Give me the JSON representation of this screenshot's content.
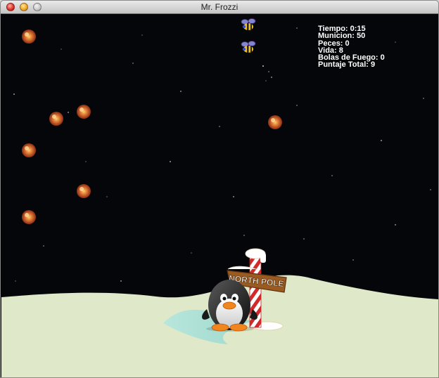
{
  "window": {
    "title": "Mr. Frozzi"
  },
  "hud": {
    "time": {
      "label": "Tiempo:",
      "value": "0:15"
    },
    "ammo": {
      "label": "Municion:",
      "value": "50"
    },
    "fish": {
      "label": "Peces:",
      "value": "0"
    },
    "life": {
      "label": "Vida:",
      "value": "8"
    },
    "fireballs": {
      "label": "Bolas de Fuego:",
      "value": "0"
    },
    "score": {
      "label": "Puntaje Total:",
      "value": "9"
    }
  },
  "sign": {
    "text": "NORTH POLE"
  },
  "colors": {
    "sky": "#04060a",
    "snow": "#dfe8c8",
    "ice": "#a8dcd0",
    "meteor": "#c0502a",
    "sign_wood": "#9a5a20"
  },
  "icons": [
    "close-button-icon",
    "minimize-button-icon",
    "zoom-button-icon",
    "meteor-icon",
    "bee-enemy-icon",
    "penguin-player-icon",
    "north-pole-sign-icon"
  ]
}
